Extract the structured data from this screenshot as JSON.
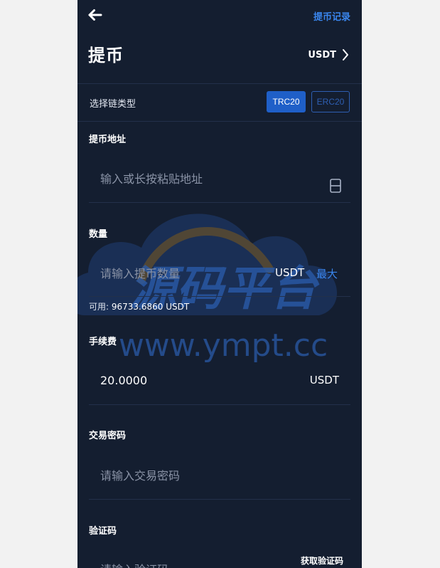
{
  "header": {
    "title": "提币",
    "history_label": "提币记录",
    "coin": "USDT"
  },
  "chain": {
    "label": "选择链类型",
    "options": [
      "TRC20",
      "ERC20"
    ],
    "selected": "TRC20"
  },
  "address": {
    "label": "提币地址",
    "placeholder": "输入或长按粘贴地址"
  },
  "amount": {
    "label": "数量",
    "placeholder": "请输入提币数量",
    "unit": "USDT",
    "max_label": "最大",
    "available_label": "可用:",
    "available_value": "96733.6860 USDT"
  },
  "fee": {
    "label": "手续费",
    "value": "20.0000",
    "unit": "USDT"
  },
  "password": {
    "label": "交易密码",
    "placeholder": "请输入交易密码"
  },
  "verify": {
    "label": "验证码",
    "placeholder": "请输入验证码",
    "button_label": "获取验证码"
  },
  "watermark": {
    "text": "源码平台",
    "url": "www.ympt.cc"
  },
  "colors": {
    "background": "#141e30",
    "accent": "#3a86ee",
    "selected_chain": "#1f5fc8"
  }
}
